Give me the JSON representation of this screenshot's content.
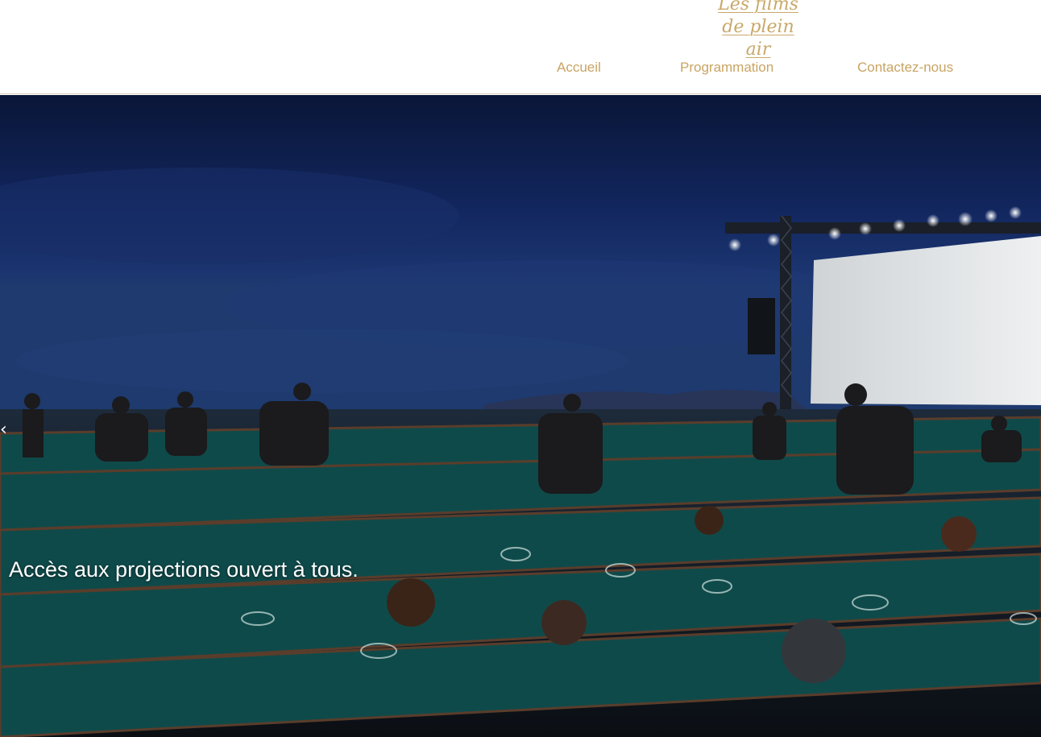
{
  "header": {
    "logo": {
      "line1": "Les films",
      "line2": "de plein air"
    },
    "nav": [
      {
        "label": "Accueil"
      },
      {
        "label": "Programmation"
      },
      {
        "label": "Contactez-nous"
      }
    ]
  },
  "hero": {
    "caption": "Accès aux projections ouvert à tous.",
    "prev_arrow_glyph": "‹",
    "image_icon": "outdoor-cinema-photo"
  },
  "colors": {
    "accent": "#c9a463",
    "sky": "#0e1c4a",
    "chairs": "#0f4a4a"
  }
}
